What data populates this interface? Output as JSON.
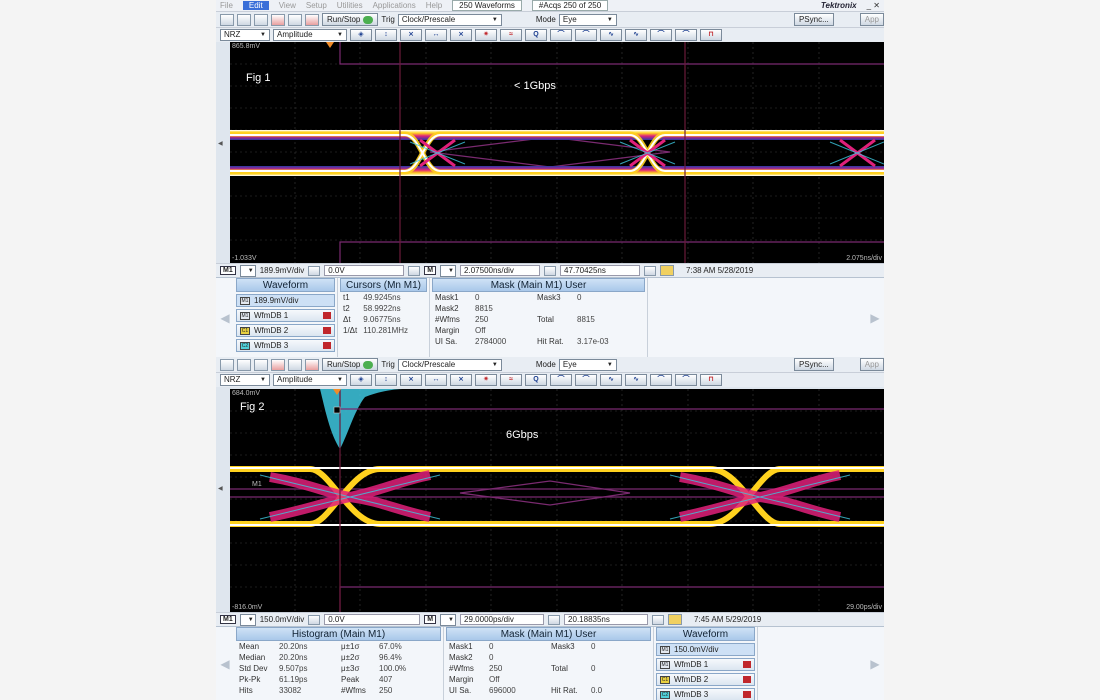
{
  "common": {
    "menu": [
      "File",
      "Edit",
      "View",
      "Setup",
      "Utilities",
      "Applications",
      "Help"
    ],
    "run_stop": "Run/Stop",
    "trig_label": "Trig",
    "trig_value": "Clock/Prescale",
    "mode_label": "Mode",
    "mode_value": "Eye",
    "psync": "PSync...",
    "app": "App",
    "brand": "Tektronix",
    "nrz": "NRZ",
    "amplitude": "Amplitude",
    "ch_m1": "M1",
    "ch_c1": "C1",
    "wf_items": [
      "WfmDB 1",
      "WfmDB 2",
      "WfmDB 3"
    ],
    "colors": {
      "eye_yellow": "#ffd21e",
      "eye_magenta": "#e0207a",
      "eye_cyan": "#3ec8e0",
      "mask_purple": "#7a2a70"
    }
  },
  "fig1": {
    "waveforms_box": "250 Waveforms",
    "acqs": "#Acqs  250 of 250",
    "fig_label": "Fig 1",
    "rate": "< 1Gbps",
    "top_level": "865.8mV",
    "bottom_level": "-1.033V",
    "timescale": "2.075ns/div",
    "status": {
      "vdiv": "189.9mV/div",
      "offset": "0.0V",
      "hdiv": "2.07500ns/div",
      "pos": "47.70425ns",
      "time": "7:38 AM 5/28/2019"
    },
    "waveform_panel": {
      "title": "Waveform",
      "first": "189.9mV/div"
    },
    "cursors": {
      "title": "Cursors (Mn M1)",
      "rows": [
        {
          "k": "t1",
          "v": "49.9245ns"
        },
        {
          "k": "t2",
          "v": "58.9922ns"
        },
        {
          "k": "Δt",
          "v": "9.06775ns"
        },
        {
          "k": "1/Δt",
          "v": "110.281MHz"
        }
      ]
    },
    "mask": {
      "title": "Mask (Main  M1) User",
      "rows": [
        {
          "k1": "Mask1",
          "v1": "0",
          "k2": "Mask3",
          "v2": "0"
        },
        {
          "k1": "Mask2",
          "v1": "8815",
          "k2": "",
          "v2": ""
        },
        {
          "k1": "#Wfms",
          "v1": "250",
          "k2": "Total",
          "v2": "8815"
        },
        {
          "k1": "Margin",
          "v1": "Off",
          "k2": "",
          "v2": ""
        },
        {
          "k1": "UI Sa.",
          "v1": "2784000",
          "k2": "Hit Rat.",
          "v2": "3.17e-03"
        }
      ]
    }
  },
  "fig2": {
    "fig_label": "Fig 2",
    "rate": "6Gbps",
    "top_level": "684.0mV",
    "bottom_level": "-816.0mV",
    "timescale": "29.00ps/div",
    "m1_marker": "M1",
    "status": {
      "vdiv": "150.0mV/div",
      "offset": "0.0V",
      "hdiv": "29.0000ps/div",
      "pos": "20.18835ns",
      "time": "7:45 AM 5/29/2019"
    },
    "histogram": {
      "title": "Histogram (Main  M1)",
      "rows": [
        {
          "k1": "Mean",
          "v1": "20.20ns",
          "k2": "μ±1σ",
          "v2": "67.0%"
        },
        {
          "k1": "Median",
          "v1": "20.20ns",
          "k2": "μ±2σ",
          "v2": "96.4%"
        },
        {
          "k1": "Std Dev",
          "v1": "9.507ps",
          "k2": "μ±3σ",
          "v2": "100.0%"
        },
        {
          "k1": "Pk-Pk",
          "v1": "61.19ps",
          "k2": "Peak",
          "v2": "407"
        },
        {
          "k1": "Hits",
          "v1": "33082",
          "k2": "#Wfms",
          "v2": "250"
        }
      ]
    },
    "mask": {
      "title": "Mask (Main  M1) User",
      "rows": [
        {
          "k1": "Mask1",
          "v1": "0",
          "k2": "Mask3",
          "v2": "0"
        },
        {
          "k1": "Mask2",
          "v1": "0",
          "k2": "",
          "v2": ""
        },
        {
          "k1": "#Wfms",
          "v1": "250",
          "k2": "Total",
          "v2": "0"
        },
        {
          "k1": "Margin",
          "v1": "Off",
          "k2": "",
          "v2": ""
        },
        {
          "k1": "UI Sa.",
          "v1": "696000",
          "k2": "Hit Rat.",
          "v2": "0.0"
        }
      ]
    },
    "waveform_panel": {
      "title": "Waveform",
      "first": "150.0mV/div"
    }
  }
}
